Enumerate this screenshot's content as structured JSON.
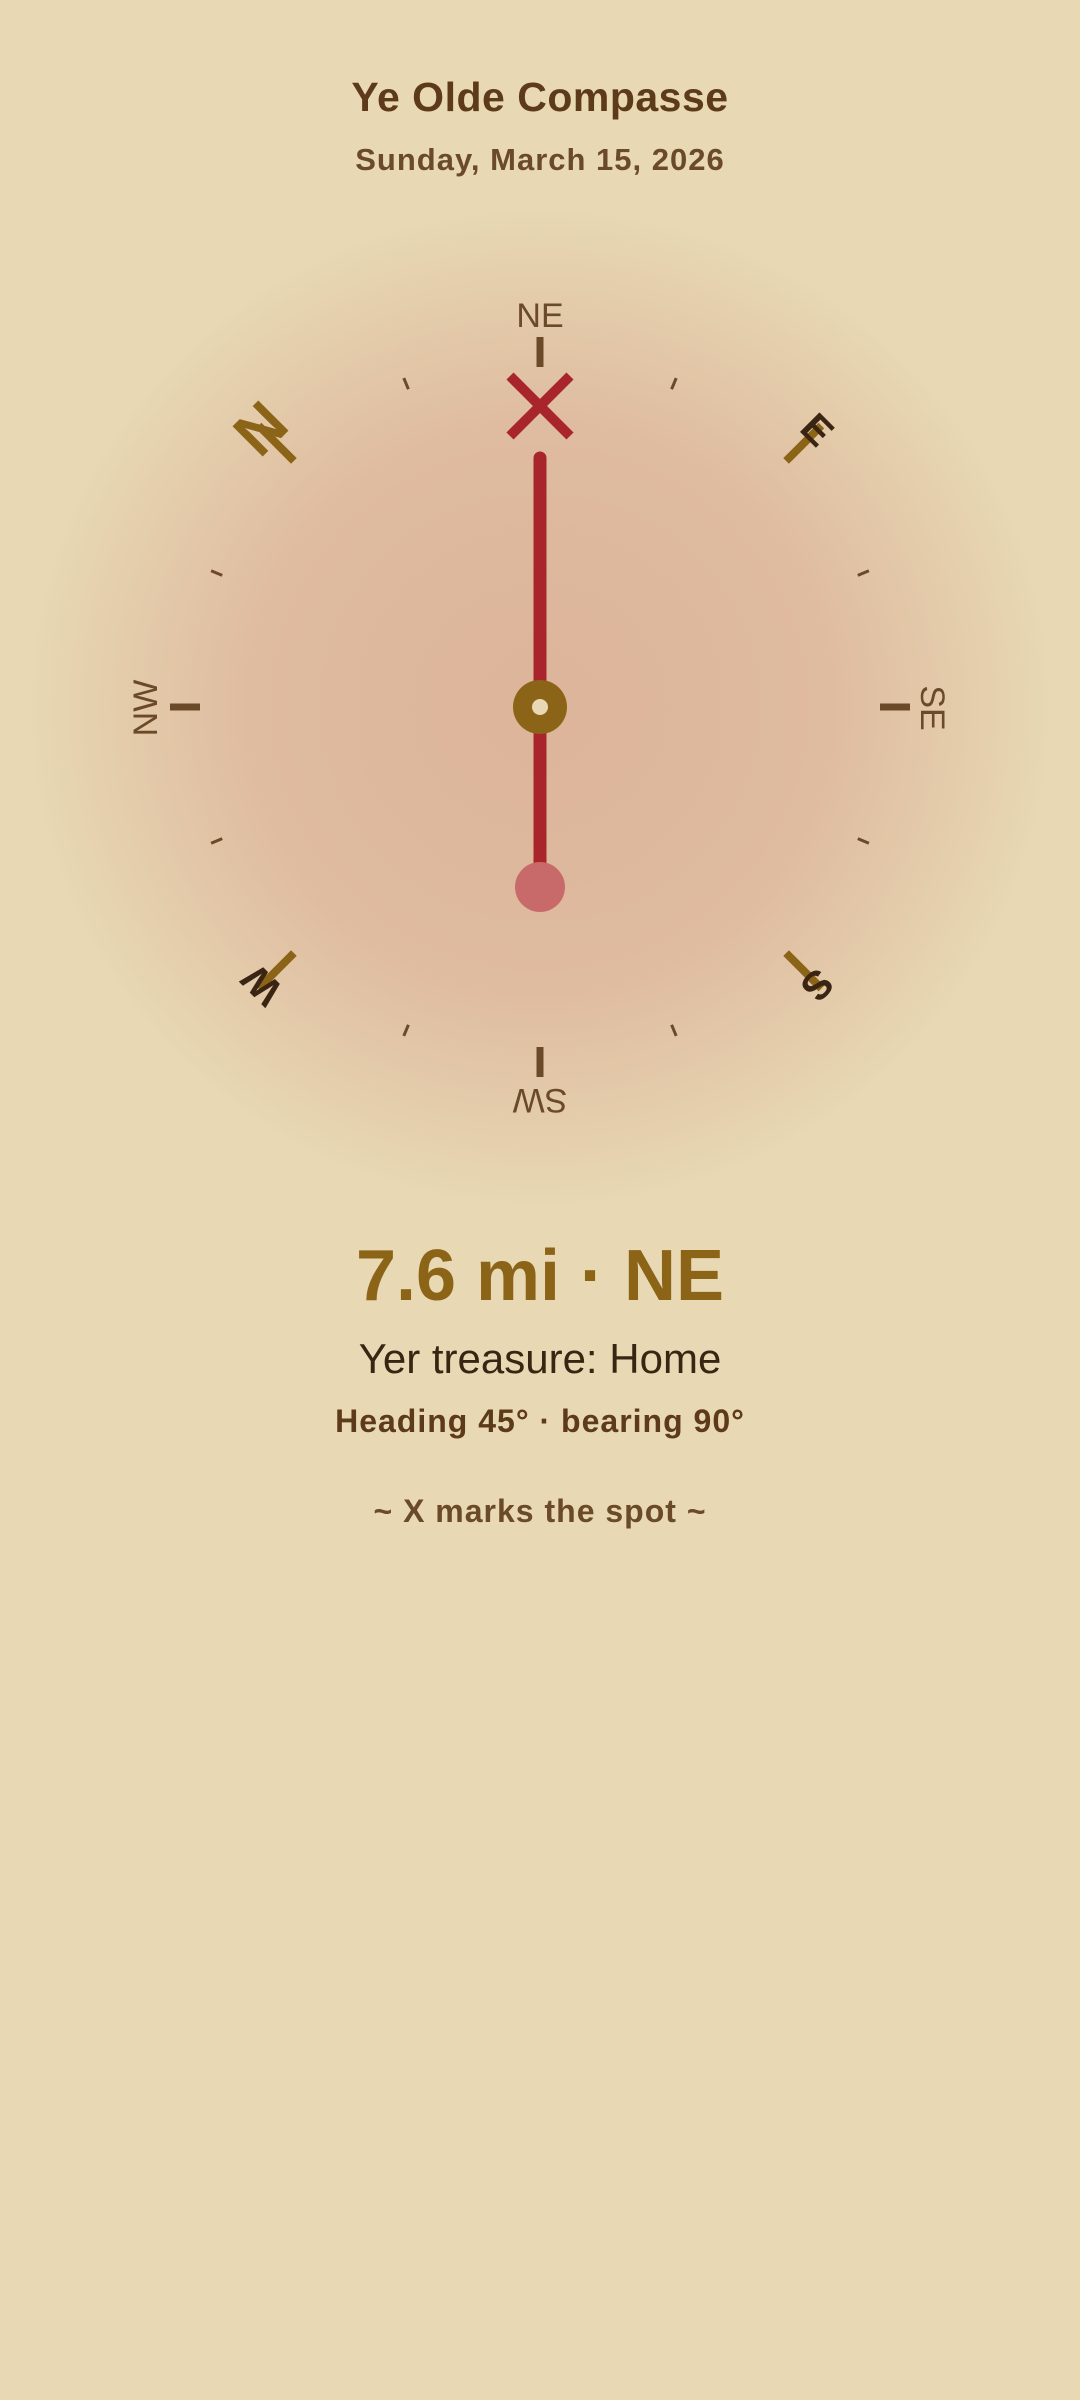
{
  "app": {
    "title": "Ye Olde Compasse",
    "date": "Sunday, March 15, 2026"
  },
  "compass": {
    "heading_deg": 45,
    "bearing_deg": 90,
    "cardinals": {
      "N": "N",
      "E": "E",
      "S": "S",
      "W": "W"
    },
    "intercardinals": {
      "NE": "NE",
      "SE": "SE",
      "SW": "SW",
      "NW": "NW"
    },
    "target_marker": "X",
    "colors": {
      "cardinal_gold": "#8b6417",
      "cardinal_dark": "#3a2512",
      "needle_red": "#a8262b",
      "needle_tail": "#c86a6a",
      "tick": "#6b4a2a",
      "hub": "#8b6417"
    }
  },
  "info": {
    "distance_line": "7.6 mi · NE",
    "treasure_line": "Yer treasure: Home",
    "heading_line": "Heading 45° · bearing 90°",
    "motto": "~ X marks the spot ~"
  }
}
